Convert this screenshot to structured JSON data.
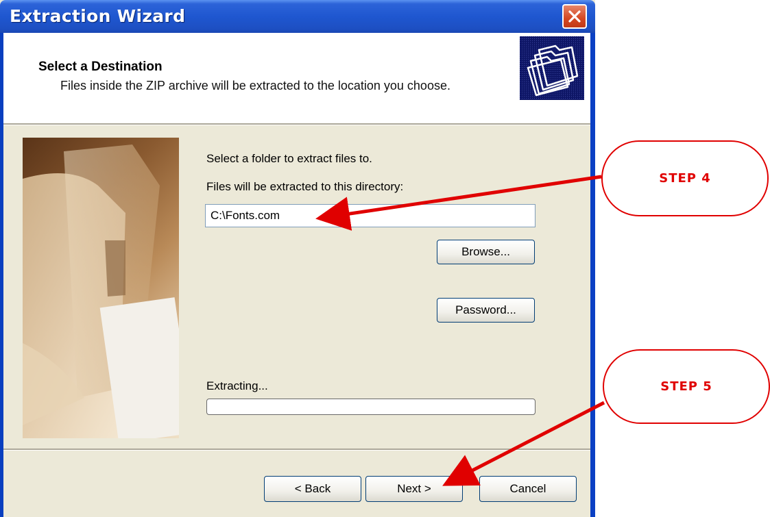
{
  "window": {
    "title": "Extraction Wizard"
  },
  "header": {
    "title": "Select a Destination",
    "subtitle": "Files inside the ZIP archive will be extracted to the location you choose."
  },
  "content": {
    "instruction": "Select a folder to extract files to.",
    "directory_label": "Files will be extracted to this directory:",
    "directory_value": "C:\\Fonts.com",
    "browse_label": "Browse...",
    "password_label": "Password...",
    "extracting_label": "Extracting...",
    "progress": 0
  },
  "footer": {
    "back_label": "< Back",
    "next_label": "Next >",
    "cancel_label": "Cancel"
  },
  "annotations": {
    "step4": "STEP 4",
    "step5": "STEP 5"
  },
  "colors": {
    "titlebar": "#1f57d0",
    "dialog_bg": "#ece9d8",
    "annotation": "#e00000"
  },
  "icons": {
    "close": "close-icon",
    "header": "folders-icon"
  }
}
